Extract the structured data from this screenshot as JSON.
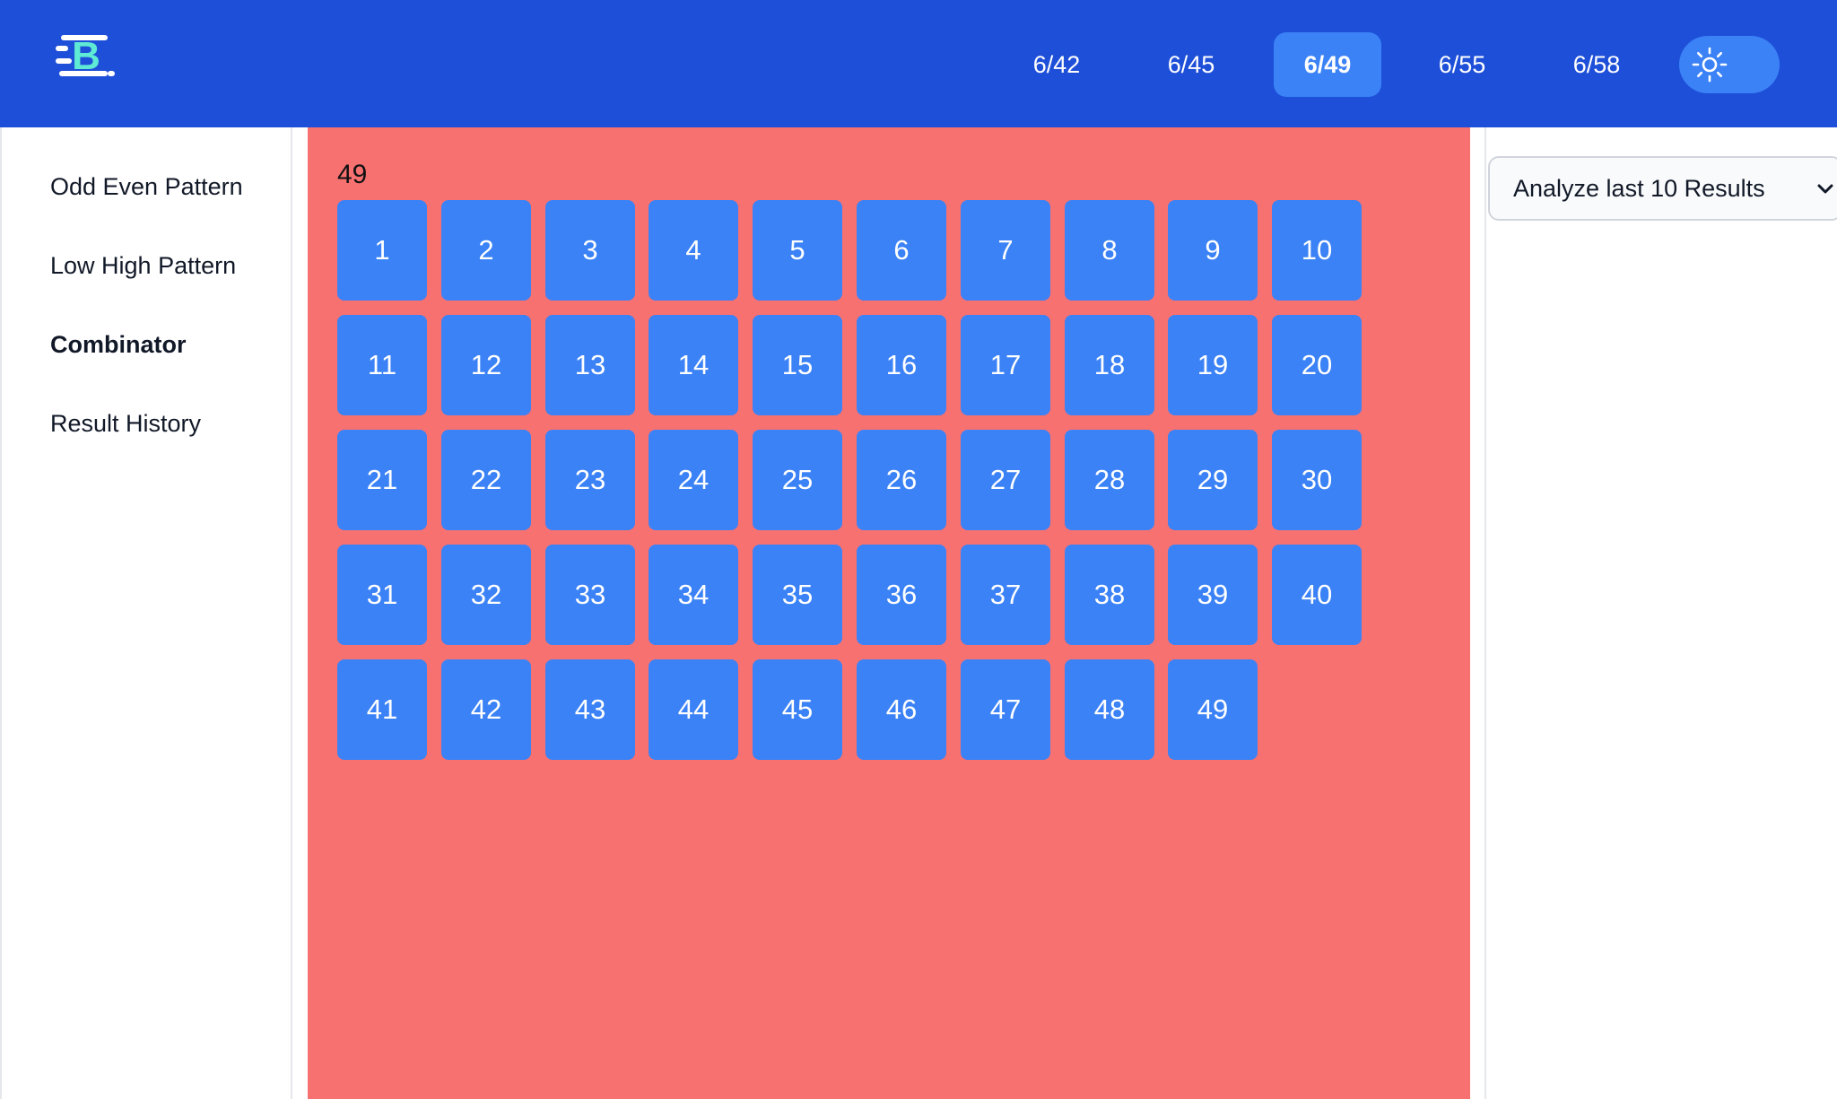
{
  "header": {
    "logo_letter": "B",
    "tabs": [
      {
        "label": "6/42",
        "active": false
      },
      {
        "label": "6/45",
        "active": false
      },
      {
        "label": "6/49",
        "active": true
      },
      {
        "label": "6/55",
        "active": false
      },
      {
        "label": "6/58",
        "active": false
      }
    ],
    "theme_icon": "sun-icon"
  },
  "sidebar": {
    "items": [
      {
        "label": "Odd Even Pattern",
        "active": false
      },
      {
        "label": "Low High Pattern",
        "active": false
      },
      {
        "label": "Combinator",
        "active": true
      },
      {
        "label": "Result History",
        "active": false
      }
    ]
  },
  "main": {
    "count_label": "49",
    "numbers": [
      "1",
      "2",
      "3",
      "4",
      "5",
      "6",
      "7",
      "8",
      "9",
      "10",
      "11",
      "12",
      "13",
      "14",
      "15",
      "16",
      "17",
      "18",
      "19",
      "20",
      "21",
      "22",
      "23",
      "24",
      "25",
      "26",
      "27",
      "28",
      "29",
      "30",
      "31",
      "32",
      "33",
      "34",
      "35",
      "36",
      "37",
      "38",
      "39",
      "40",
      "41",
      "42",
      "43",
      "44",
      "45",
      "46",
      "47",
      "48",
      "49"
    ]
  },
  "right_panel": {
    "analyze_select_value": "Analyze last 10 Results"
  },
  "colors": {
    "header_bg": "#1e4fd8",
    "accent": "#3b82f6",
    "main_bg": "#f87171"
  }
}
